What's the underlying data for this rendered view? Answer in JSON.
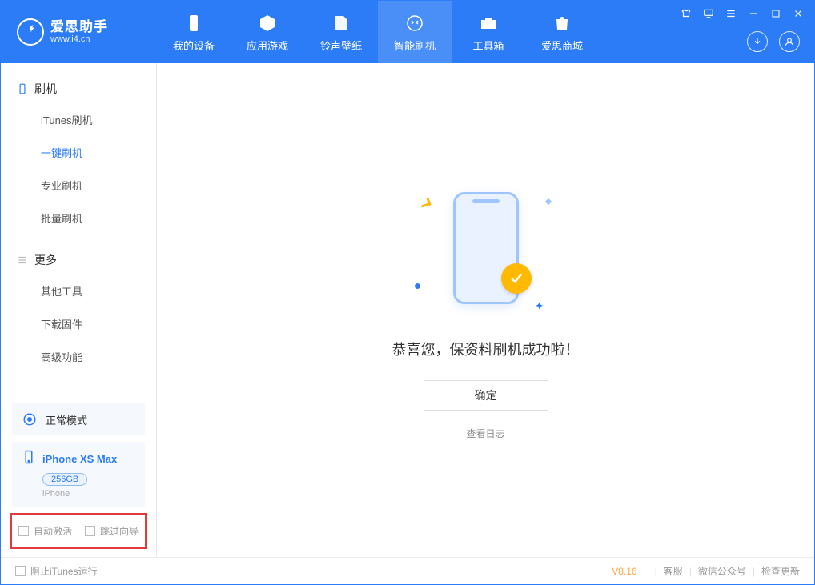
{
  "app": {
    "title": "爱思助手",
    "subtitle": "www.i4.cn"
  },
  "nav": {
    "items": [
      {
        "label": "我的设备"
      },
      {
        "label": "应用游戏"
      },
      {
        "label": "铃声壁纸"
      },
      {
        "label": "智能刷机"
      },
      {
        "label": "工具箱"
      },
      {
        "label": "爱思商城"
      }
    ],
    "active_index": 3
  },
  "sidebar": {
    "groups": [
      {
        "title": "刷机",
        "icon": "phone",
        "items": [
          {
            "label": "iTunes刷机"
          },
          {
            "label": "一键刷机"
          },
          {
            "label": "专业刷机"
          },
          {
            "label": "批量刷机"
          }
        ],
        "active_index": 1
      },
      {
        "title": "更多",
        "icon": "list",
        "items": [
          {
            "label": "其他工具"
          },
          {
            "label": "下载固件"
          },
          {
            "label": "高级功能"
          }
        ]
      }
    ],
    "mode_panel": {
      "label": "正常模式"
    },
    "device": {
      "name": "iPhone XS Max",
      "storage": "256GB",
      "type": "iPhone"
    },
    "options": {
      "auto_activate": "自动激活",
      "skip_guide": "跳过向导"
    }
  },
  "main": {
    "success_text": "恭喜您，保资料刷机成功啦！",
    "confirm": "确定",
    "view_log": "查看日志"
  },
  "statusbar": {
    "stop_itunes": "阻止iTunes运行",
    "version": "V8.16",
    "links": [
      "客服",
      "微信公众号",
      "检查更新"
    ]
  }
}
